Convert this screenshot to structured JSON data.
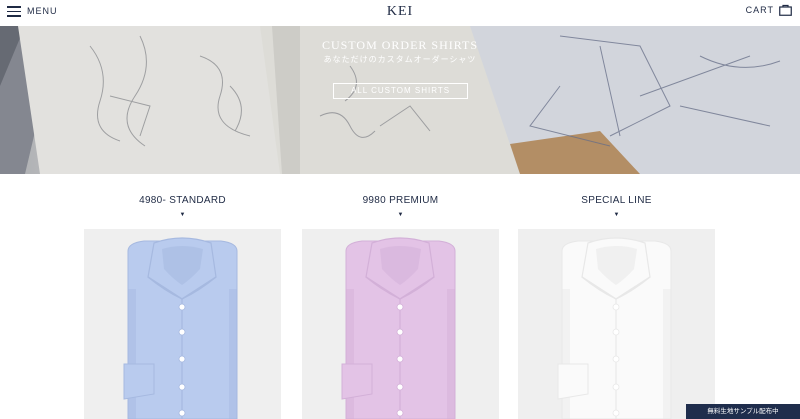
{
  "header": {
    "menu_label": "MENU",
    "logo": "KEI",
    "cart_label": "CART"
  },
  "hero": {
    "title": "CUSTOM ORDER SHIRTS",
    "subtitle": "あなただけのカスタムオーダーシャツ",
    "cta_label": "ALL CUSTOM SHIRTS"
  },
  "products": [
    {
      "title": "4980- STANDARD",
      "arrow": "▼",
      "shirt_color": "#b9cbee",
      "shirt_shade": "#a6b9e0"
    },
    {
      "title": "9980 PREMIUM",
      "arrow": "▼",
      "shirt_color": "#e3c3e6",
      "shirt_shade": "#d3b0d8"
    },
    {
      "title": "SPECIAL LINE",
      "arrow": "▼",
      "shirt_color": "#fafafa",
      "shirt_shade": "#e8e8e8"
    }
  ],
  "badge": {
    "label": "無料生地サンプル配布中"
  },
  "colors": {
    "navy": "#1f2a44",
    "badge_bg": "#1f2d4c",
    "card_bg": "#efefef"
  }
}
